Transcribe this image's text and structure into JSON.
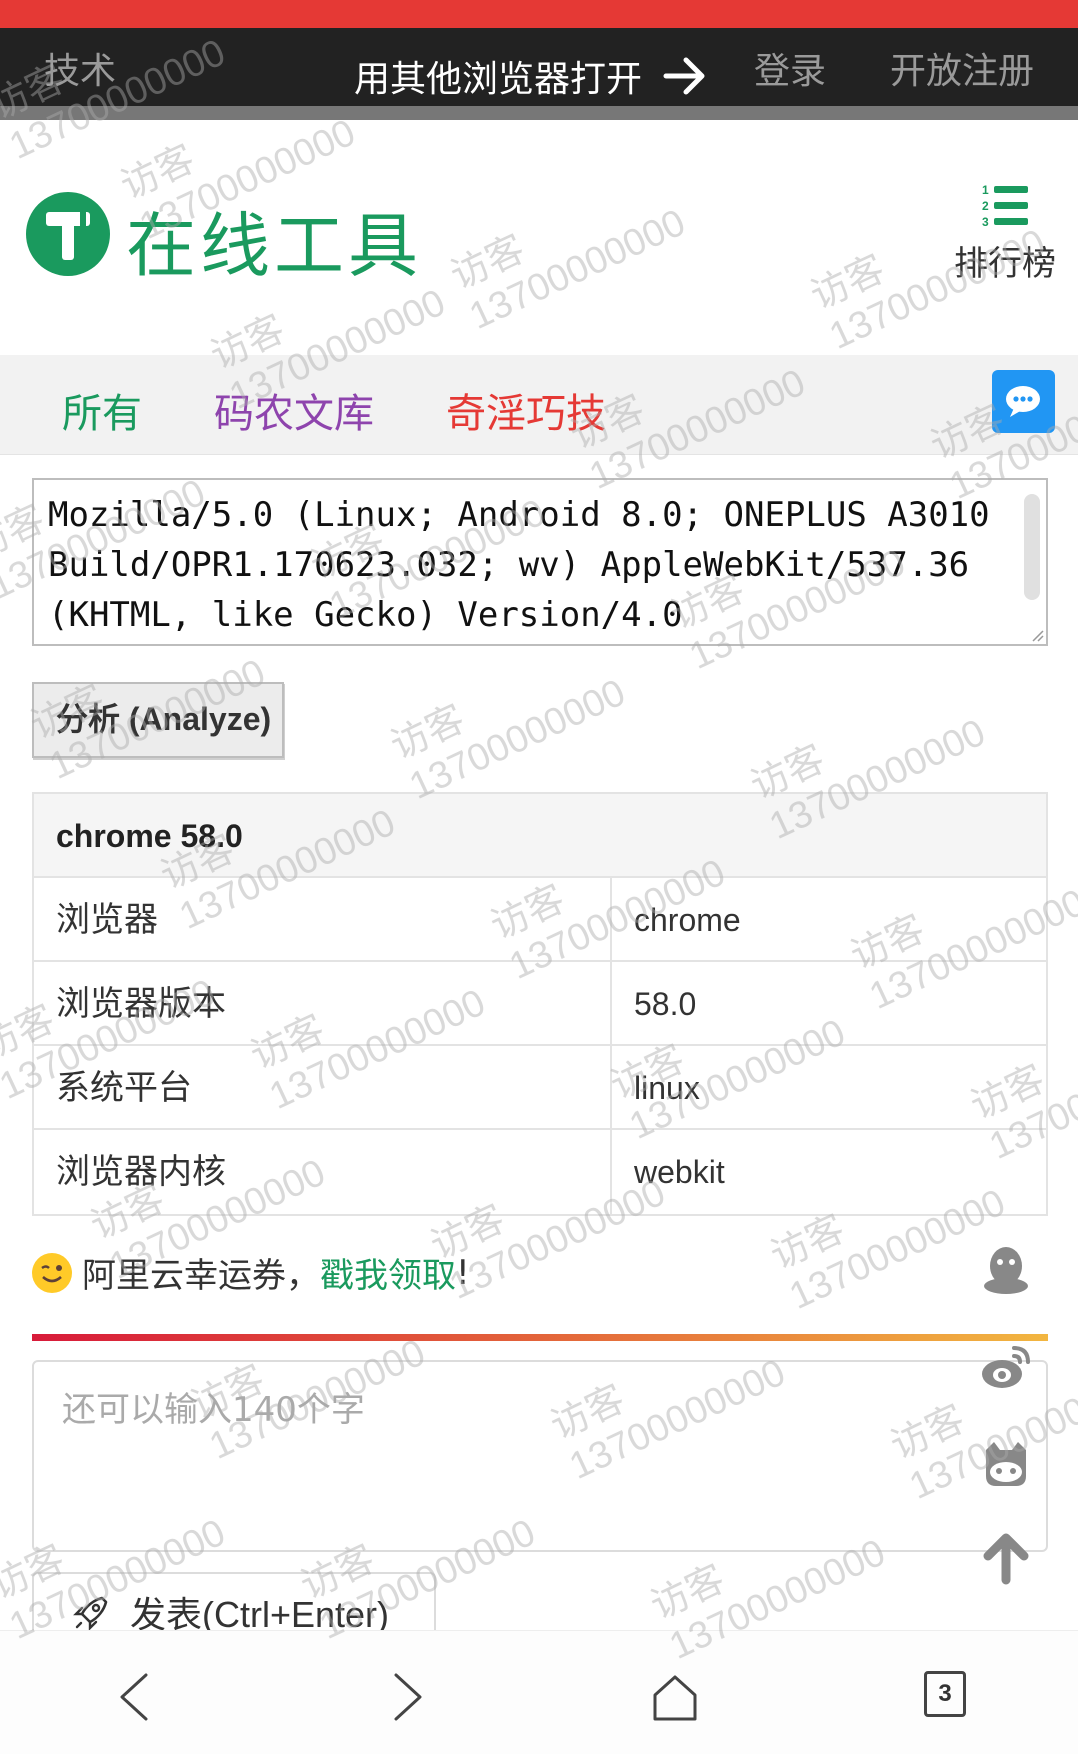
{
  "top_nav": {
    "left_link": "技术",
    "open_in_browser": "用其他浏览器打开",
    "login": "登录",
    "register": "开放注册"
  },
  "header": {
    "site_title": "在线工具",
    "rank_label": "排行榜"
  },
  "categories": [
    {
      "label": "所有",
      "color": "#1a9a5e"
    },
    {
      "label": "码农文库",
      "color": "#8e44ad"
    },
    {
      "label": "奇淫巧技",
      "color": "#e53935"
    }
  ],
  "ua_input": {
    "value": "Mozilla/5.0 (Linux; Android 8.0; ONEPLUS A3010\nBuild/OPR1.170623.032; wv) AppleWebKit/537.36\n(KHTML, like Gecko) Version/4.0"
  },
  "analyze_button": "分析 (Analyze)",
  "result": {
    "heading": "chrome 58.0",
    "rows": [
      {
        "key": "浏览器",
        "value": "chrome"
      },
      {
        "key": "浏览器版本",
        "value": "58.0"
      },
      {
        "key": "系统平台",
        "value": "linux"
      },
      {
        "key": "浏览器内核",
        "value": "webkit"
      }
    ]
  },
  "promo": {
    "text": "阿里云幸运券，",
    "link": "戳我领取",
    "suffix": "!"
  },
  "comment": {
    "placeholder": "还可以输入140个字",
    "submit": "发表(Ctrl+Enter)"
  },
  "browser_bar": {
    "tab_count": "3"
  },
  "watermark": {
    "label": "访客",
    "number": "13700000000"
  },
  "colors": {
    "brand_green": "#1a9a5e",
    "status_red": "#e53935",
    "chat_blue": "#2196f3"
  }
}
